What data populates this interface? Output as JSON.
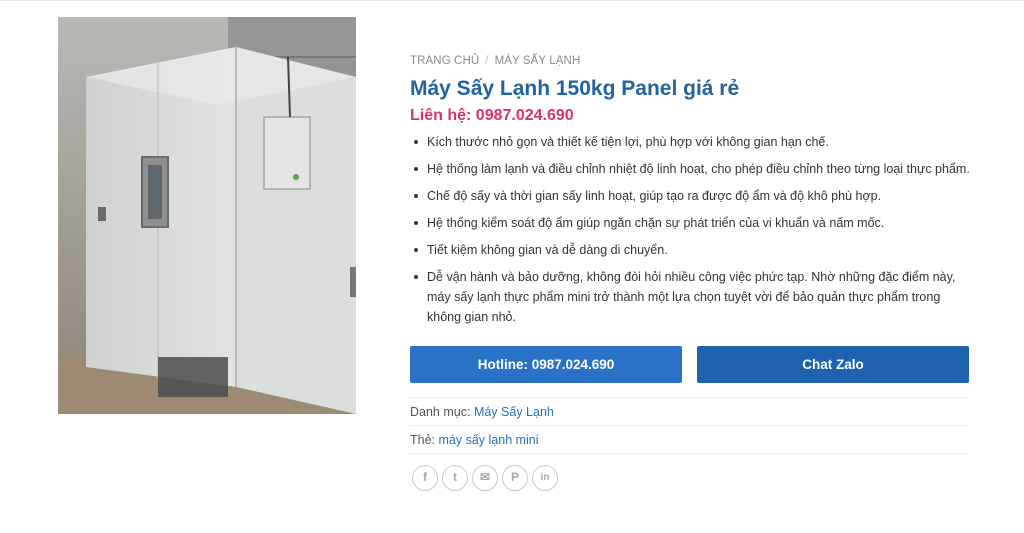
{
  "product": {
    "image_alt": "Máy sấy lạnh 150kg panel",
    "breadcrumb": [
      {
        "label": "TRANG CHỦ"
      },
      {
        "label": "MÁY SẤY LẠNH"
      }
    ],
    "breadcrumb_sep": "/",
    "title": "Máy Sấy Lạnh 150kg Panel giá rẻ",
    "price_label": "Liên hệ:",
    "price_phone": "0987.024.690",
    "features": [
      "Kích thước nhỏ gọn và thiết kế tiện lợi, phù hợp với không gian hạn chế.",
      "Hệ thống làm lạnh và điều chỉnh nhiệt độ linh hoạt, cho phép điều chỉnh theo từng loại thực phẩm.",
      "Chế độ sấy và thời gian sấy linh hoạt, giúp tạo ra được độ ẩm và độ khô phù hợp.",
      "Hệ thống kiểm soát độ ẩm giúp ngăn chặn sự phát triển của vi khuẩn và nấm mốc.",
      "Tiết kiệm không gian và dễ dàng di chuyển.",
      "Dễ vận hành và bảo dưỡng, không đòi hỏi nhiều công việc phức tạp. Nhờ những đặc điểm này, máy sấy lạnh thực phẩm mini trở thành một lựa chọn tuyệt vời để bảo quản thực phẩm trong không gian nhỏ."
    ],
    "buttons": {
      "hotline": "Hotline: 0987.024.690",
      "zalo": "Chat Zalo"
    },
    "category_label": "Danh mục:",
    "category_value": "Máy Sấy Lạnh",
    "tag_label": "Thẻ:",
    "tag_value": "máy sấy lạnh mini",
    "share_icons": [
      "facebook-icon",
      "twitter-icon",
      "email-icon",
      "pinterest-icon",
      "linkedin-icon"
    ],
    "share_glyphs": [
      "f",
      "t",
      "✉",
      "P",
      "in"
    ]
  },
  "colors": {
    "title": "#22649e",
    "price": "#d6336c",
    "button_hotline": "#2a72c7",
    "button_zalo": "#1e62b0",
    "link": "#2a6fb8"
  }
}
